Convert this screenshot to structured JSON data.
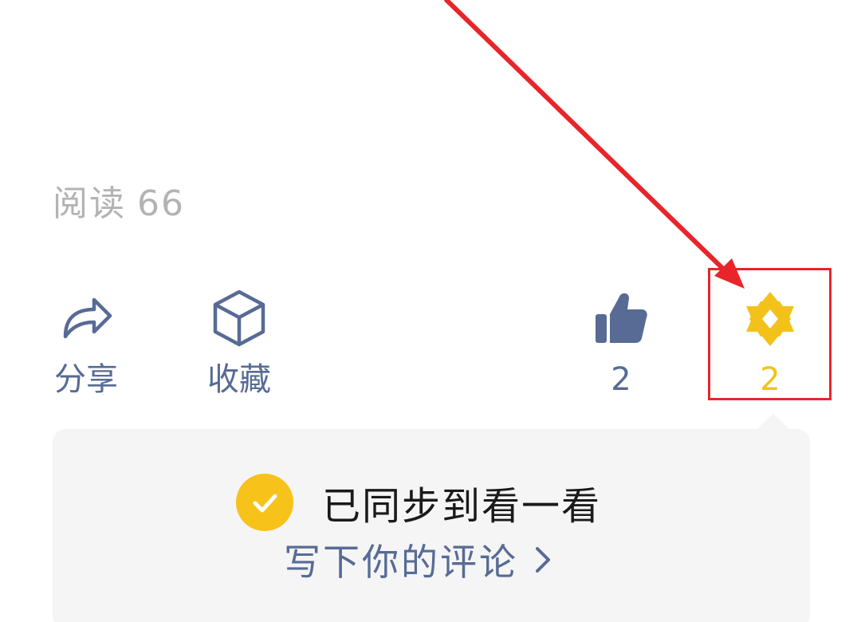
{
  "article": {
    "read_label": "阅读",
    "read_count": "66"
  },
  "actions": {
    "share": {
      "label": "分享",
      "icon": "share-arrow-icon"
    },
    "collect": {
      "label": "收藏",
      "icon": "cube-icon"
    },
    "like": {
      "count": "2",
      "icon": "thumbs-up-icon"
    },
    "wow": {
      "count": "2",
      "icon": "wow-star-icon"
    }
  },
  "popup": {
    "sync_text": "已同步到看一看",
    "comment_link": "写下你的评论",
    "check_icon": "check-circle-icon",
    "chevron_icon": "chevron-right-icon"
  },
  "colors": {
    "link_blue": "#576b95",
    "wow_yellow": "#f2c21a",
    "annotation_red": "#e8252a",
    "muted_gray": "#b3b3b3",
    "card_bg": "#f5f5f6"
  }
}
